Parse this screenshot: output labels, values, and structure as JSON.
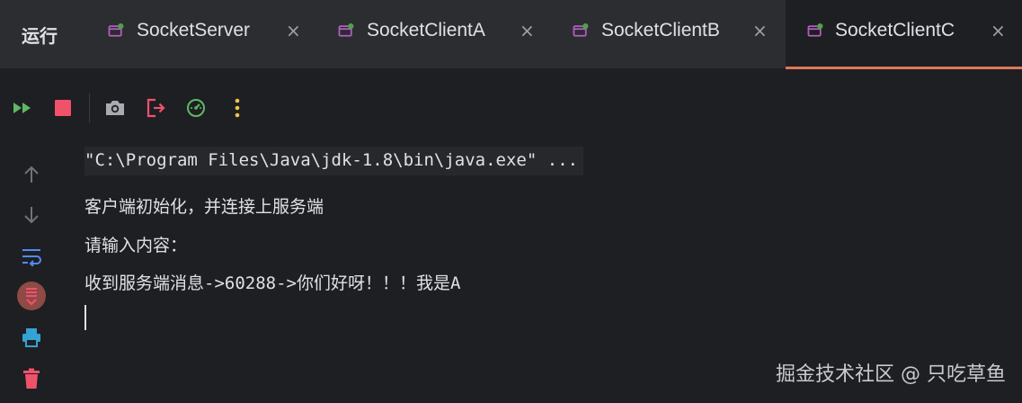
{
  "tabbar": {
    "run_label": "运行",
    "tabs": [
      {
        "label": "SocketServer",
        "close": "×"
      },
      {
        "label": "SocketClientA",
        "close": "×"
      },
      {
        "label": "SocketClientB",
        "close": "×"
      },
      {
        "label": "SocketClientC",
        "close": "×"
      }
    ],
    "active_tab": "SocketClientC"
  },
  "toolbar": {
    "icons": [
      "rerun-icon",
      "stop-icon",
      "camera-icon",
      "exit-icon",
      "profiler-icon",
      "more-vert-icon"
    ],
    "more_label": "⋮"
  },
  "gutter": {
    "icons": [
      "arrow-up-icon",
      "arrow-down-icon",
      "soft-wrap-icon",
      "scroll-to-end-icon",
      "print-icon",
      "trash-icon"
    ]
  },
  "console": {
    "lines": [
      "\"C:\\Program Files\\Java\\jdk-1.8\\bin\\java.exe\" ...",
      "客户端初始化，并连接上服务端",
      "请输入内容：",
      "收到服务端消息->60288->你们好呀！！！我是A"
    ]
  },
  "watermark": "掘金技术社区 @ 只吃草鱼",
  "colors": {
    "background": "#1e1f22",
    "tabbar": "#2b2d30",
    "active_underline": "#e0775b",
    "stop": "#f0526b",
    "rerun": "#5fb865",
    "tab_icon": "#b35ebf",
    "dot": "#4ea34a",
    "print": "#35a2d4",
    "more": "#f2c54b"
  }
}
